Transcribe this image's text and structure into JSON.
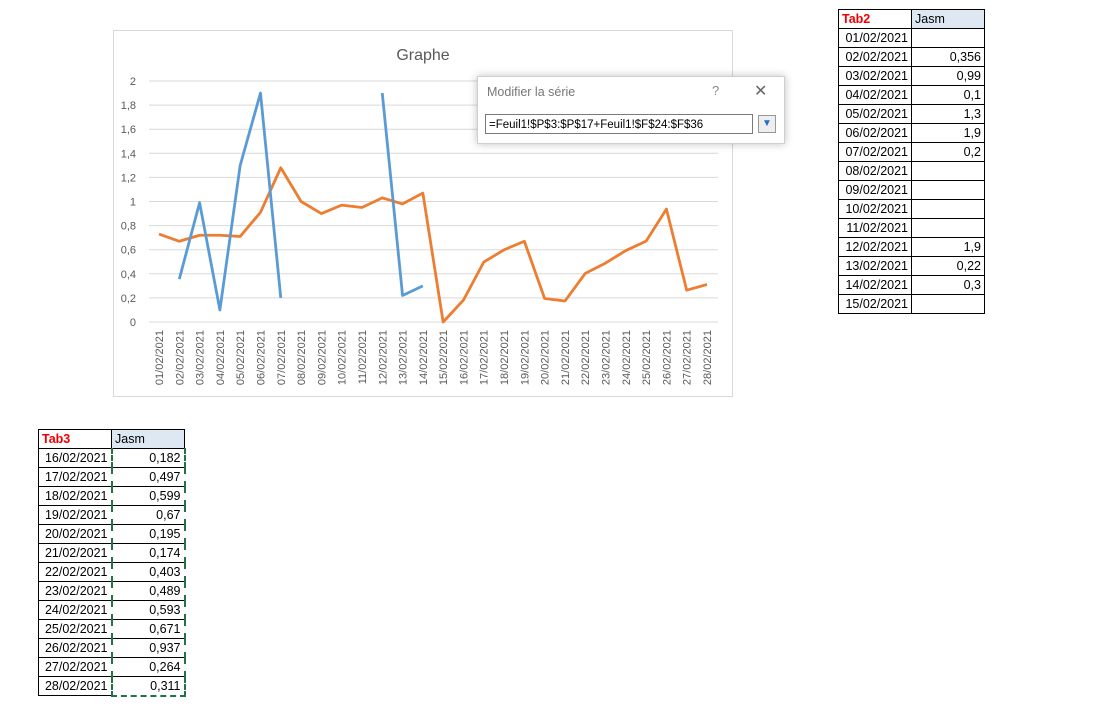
{
  "dialog": {
    "title": "Modifier la série",
    "help": "?",
    "close": "✕",
    "formula": "=Feuil1!$P$3:$P$17+Feuil1!$F$24:$F$36"
  },
  "colors": {
    "series_orange": "#ed7d31",
    "series_blue": "#5b9bd5",
    "header_red": "#ff0000"
  },
  "chart_data": {
    "type": "line",
    "title": "Graphe",
    "xlabel": "",
    "ylabel": "",
    "ylim": [
      0,
      2
    ],
    "yticks": [
      "0",
      "0,2",
      "0,4",
      "0,6",
      "0,8",
      "1",
      "1,2",
      "1,4",
      "1,6",
      "1,8",
      "2"
    ],
    "grid": true,
    "categories": [
      "01/02/2021",
      "02/02/2021",
      "03/02/2021",
      "04/02/2021",
      "05/02/2021",
      "06/02/2021",
      "07/02/2021",
      "08/02/2021",
      "09/02/2021",
      "10/02/2021",
      "11/02/2021",
      "12/02/2021",
      "13/02/2021",
      "14/02/2021",
      "15/02/2021",
      "16/02/2021",
      "17/02/2021",
      "18/02/2021",
      "19/02/2021",
      "20/02/2021",
      "21/02/2021",
      "22/02/2021",
      "23/02/2021",
      "24/02/2021",
      "25/02/2021",
      "26/02/2021",
      "27/02/2021",
      "28/02/2021"
    ],
    "series": [
      {
        "name": "orange",
        "color": "#ed7d31",
        "values": [
          0.73,
          0.67,
          0.72,
          0.72,
          0.71,
          0.91,
          1.28,
          1.0,
          0.9,
          0.97,
          0.95,
          1.03,
          0.98,
          1.07,
          0,
          0.182,
          0.497,
          0.599,
          0.67,
          0.195,
          0.174,
          0.403,
          0.489,
          0.593,
          0.671,
          0.937,
          0.264,
          0.311
        ]
      },
      {
        "name": "blue",
        "color": "#5b9bd5",
        "values": [
          null,
          0.356,
          0.99,
          0.1,
          1.3,
          1.9,
          0.2,
          null,
          null,
          null,
          null,
          1.9,
          0.22,
          0.3,
          null,
          null,
          null,
          null,
          null,
          null,
          null,
          null,
          null,
          null,
          null,
          null,
          null,
          null
        ]
      }
    ]
  },
  "tab2": {
    "header": [
      "Tab2",
      "Jasm"
    ],
    "rows": [
      [
        "01/02/2021",
        ""
      ],
      [
        "02/02/2021",
        "0,356"
      ],
      [
        "03/02/2021",
        "0,99"
      ],
      [
        "04/02/2021",
        "0,1"
      ],
      [
        "05/02/2021",
        "1,3"
      ],
      [
        "06/02/2021",
        "1,9"
      ],
      [
        "07/02/2021",
        "0,2"
      ],
      [
        "08/02/2021",
        ""
      ],
      [
        "09/02/2021",
        ""
      ],
      [
        "10/02/2021",
        ""
      ],
      [
        "11/02/2021",
        ""
      ],
      [
        "12/02/2021",
        "1,9"
      ],
      [
        "13/02/2021",
        "0,22"
      ],
      [
        "14/02/2021",
        "0,3"
      ],
      [
        "15/02/2021",
        ""
      ]
    ]
  },
  "tab3": {
    "header": [
      "Tab3",
      "Jasm"
    ],
    "rows": [
      [
        "16/02/2021",
        "0,182"
      ],
      [
        "17/02/2021",
        "0,497"
      ],
      [
        "18/02/2021",
        "0,599"
      ],
      [
        "19/02/2021",
        "0,67"
      ],
      [
        "20/02/2021",
        "0,195"
      ],
      [
        "21/02/2021",
        "0,174"
      ],
      [
        "22/02/2021",
        "0,403"
      ],
      [
        "23/02/2021",
        "0,489"
      ],
      [
        "24/02/2021",
        "0,593"
      ],
      [
        "25/02/2021",
        "0,671"
      ],
      [
        "26/02/2021",
        "0,937"
      ],
      [
        "27/02/2021",
        "0,264"
      ],
      [
        "28/02/2021",
        "0,311"
      ]
    ]
  }
}
